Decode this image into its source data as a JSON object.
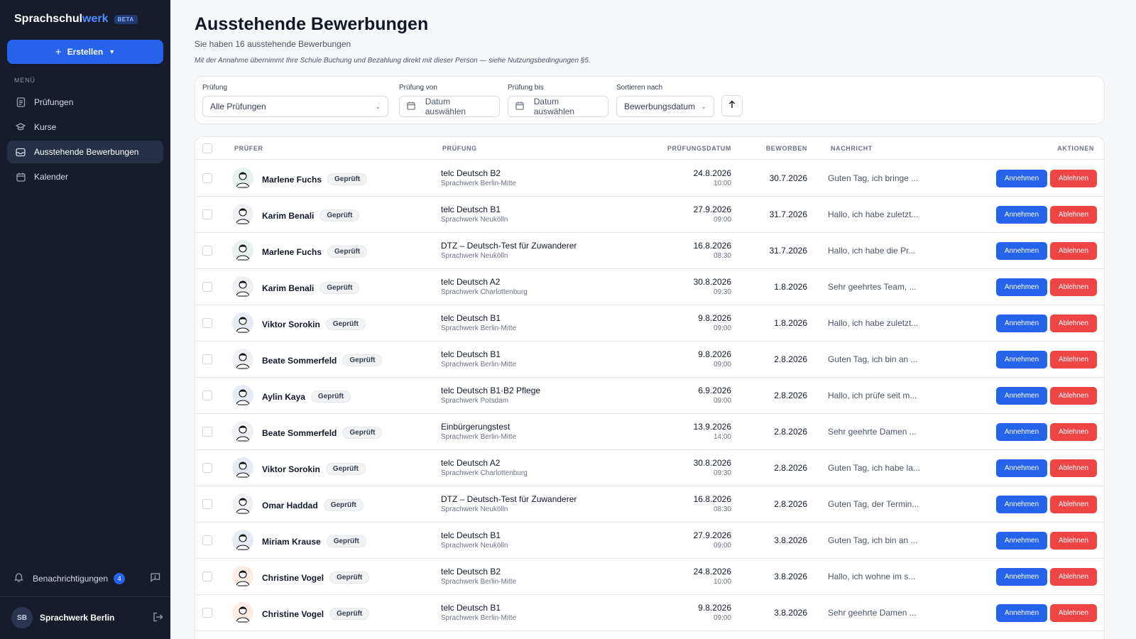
{
  "sidebar": {
    "brand_main": "Sprachschul",
    "brand_accent": "werk",
    "beta": "BETA",
    "create_label": "Erstellen",
    "menu_label": "MENÜ",
    "items": [
      {
        "label": "Prüfungen",
        "icon": "document-icon"
      },
      {
        "label": "Kurse",
        "icon": "graduation-cap-icon"
      },
      {
        "label": "Ausstehende Bewerbungen",
        "icon": "inbox-icon",
        "active": true
      },
      {
        "label": "Kalender",
        "icon": "calendar-icon"
      }
    ],
    "notifications_label": "Benachrichtigungen",
    "notifications_count": "4",
    "account_initials": "SB",
    "account_name": "Sprachwerk Berlin"
  },
  "header": {
    "title": "Ausstehende Bewerbungen",
    "subtitle": "Sie haben 16 ausstehende Bewerbungen",
    "note": "Mit der Annahme übernimmt Ihre Schule Buchung und Bezahlung direkt mit dieser Person — siehe Nutzungsbedingungen §5."
  },
  "filters": {
    "exam_label": "Prüfung",
    "exam_value": "Alle Prüfungen",
    "from_label": "Prüfung von",
    "from_placeholder": "Datum auswählen",
    "to_label": "Prüfung bis",
    "to_placeholder": "Datum auswählen",
    "sort_label": "Sortieren nach",
    "sort_value": "Bewerbungsdatum"
  },
  "table": {
    "columns": {
      "examiner": "PRÜFER",
      "exam": "PRÜFUNG",
      "exam_date": "PRÜFUNGSDATUM",
      "applied": "BEWORBEN",
      "message": "NACHRICHT",
      "actions": "AKTIONEN"
    },
    "accept_label": "Annehmen",
    "reject_label": "Ablehnen",
    "rows": [
      {
        "name": "Marlene Fuchs",
        "badge": "Geprüft",
        "exam": "telc Deutsch B2",
        "location": "Sprachwerk Berlin-Mitte",
        "date": "24.8.2026",
        "time": "10:00",
        "applied": "30.7.2026",
        "message": "Guten Tag, ich bringe ..."
      },
      {
        "name": "Karim Benali",
        "badge": "Geprüft",
        "exam": "telc Deutsch B1",
        "location": "Sprachwerk Neukölln",
        "date": "27.9.2026",
        "time": "09:00",
        "applied": "31.7.2026",
        "message": "Hallo, ich habe zuletzt..."
      },
      {
        "name": "Marlene Fuchs",
        "badge": "Geprüft",
        "exam": "DTZ – Deutsch-Test für Zuwanderer",
        "location": "Sprachwerk Neukölln",
        "date": "16.8.2026",
        "time": "08:30",
        "applied": "31.7.2026",
        "message": "Hallo, ich habe die Pr..."
      },
      {
        "name": "Karim Benali",
        "badge": "Geprüft",
        "exam": "telc Deutsch A2",
        "location": "Sprachwerk Charlottenburg",
        "date": "30.8.2026",
        "time": "09:30",
        "applied": "1.8.2026",
        "message": "Sehr geehrtes Team, ..."
      },
      {
        "name": "Viktor Sorokin",
        "badge": "Geprüft",
        "exam": "telc Deutsch B1",
        "location": "Sprachwerk Berlin-Mitte",
        "date": "9.8.2026",
        "time": "09:00",
        "applied": "1.8.2026",
        "message": "Hallo, ich habe zuletzt..."
      },
      {
        "name": "Beate Sommerfeld",
        "badge": "Geprüft",
        "exam": "telc Deutsch B1",
        "location": "Sprachwerk Berlin-Mitte",
        "date": "9.8.2026",
        "time": "09:00",
        "applied": "2.8.2026",
        "message": "Guten Tag, ich bin an ..."
      },
      {
        "name": "Aylin Kaya",
        "badge": "Geprüft",
        "exam": "telc Deutsch B1·B2 Pflege",
        "location": "Sprachwerk Potsdam",
        "date": "6.9.2026",
        "time": "09:00",
        "applied": "2.8.2026",
        "message": "Hallo, ich prüfe seit m..."
      },
      {
        "name": "Beate Sommerfeld",
        "badge": "Geprüft",
        "exam": "Einbürgerungstest",
        "location": "Sprachwerk Berlin-Mitte",
        "date": "13.9.2026",
        "time": "14:00",
        "applied": "2.8.2026",
        "message": "Sehr geehrte Damen ..."
      },
      {
        "name": "Viktor Sorokin",
        "badge": "Geprüft",
        "exam": "telc Deutsch A2",
        "location": "Sprachwerk Charlottenburg",
        "date": "30.8.2026",
        "time": "09:30",
        "applied": "2.8.2026",
        "message": "Guten Tag, ich habe la..."
      },
      {
        "name": "Omar Haddad",
        "badge": "Geprüft",
        "exam": "DTZ – Deutsch-Test für Zuwanderer",
        "location": "Sprachwerk Neukölln",
        "date": "16.8.2026",
        "time": "08:30",
        "applied": "2.8.2026",
        "message": "Guten Tag, der Termin..."
      },
      {
        "name": "Miriam Krause",
        "badge": "Geprüft",
        "exam": "telc Deutsch B1",
        "location": "Sprachwerk Neukölln",
        "date": "27.9.2026",
        "time": "09:00",
        "applied": "3.8.2026",
        "message": "Guten Tag, ich bin an ..."
      },
      {
        "name": "Christine Vogel",
        "badge": "Geprüft",
        "exam": "telc Deutsch B2",
        "location": "Sprachwerk Berlin-Mitte",
        "date": "24.8.2026",
        "time": "10:00",
        "applied": "3.8.2026",
        "message": "Hallo, ich wohne im s..."
      },
      {
        "name": "Christine Vogel",
        "badge": "Geprüft",
        "exam": "telc Deutsch B1",
        "location": "Sprachwerk Berlin-Mitte",
        "date": "9.8.2026",
        "time": "09:00",
        "applied": "3.8.2026",
        "message": "Sehr geehrte Damen ..."
      }
    ]
  },
  "colors": {
    "sidebar_bg": "#161c2b",
    "primary": "#2563eb",
    "danger": "#ef4444",
    "page_bg": "#f6f7f9"
  }
}
